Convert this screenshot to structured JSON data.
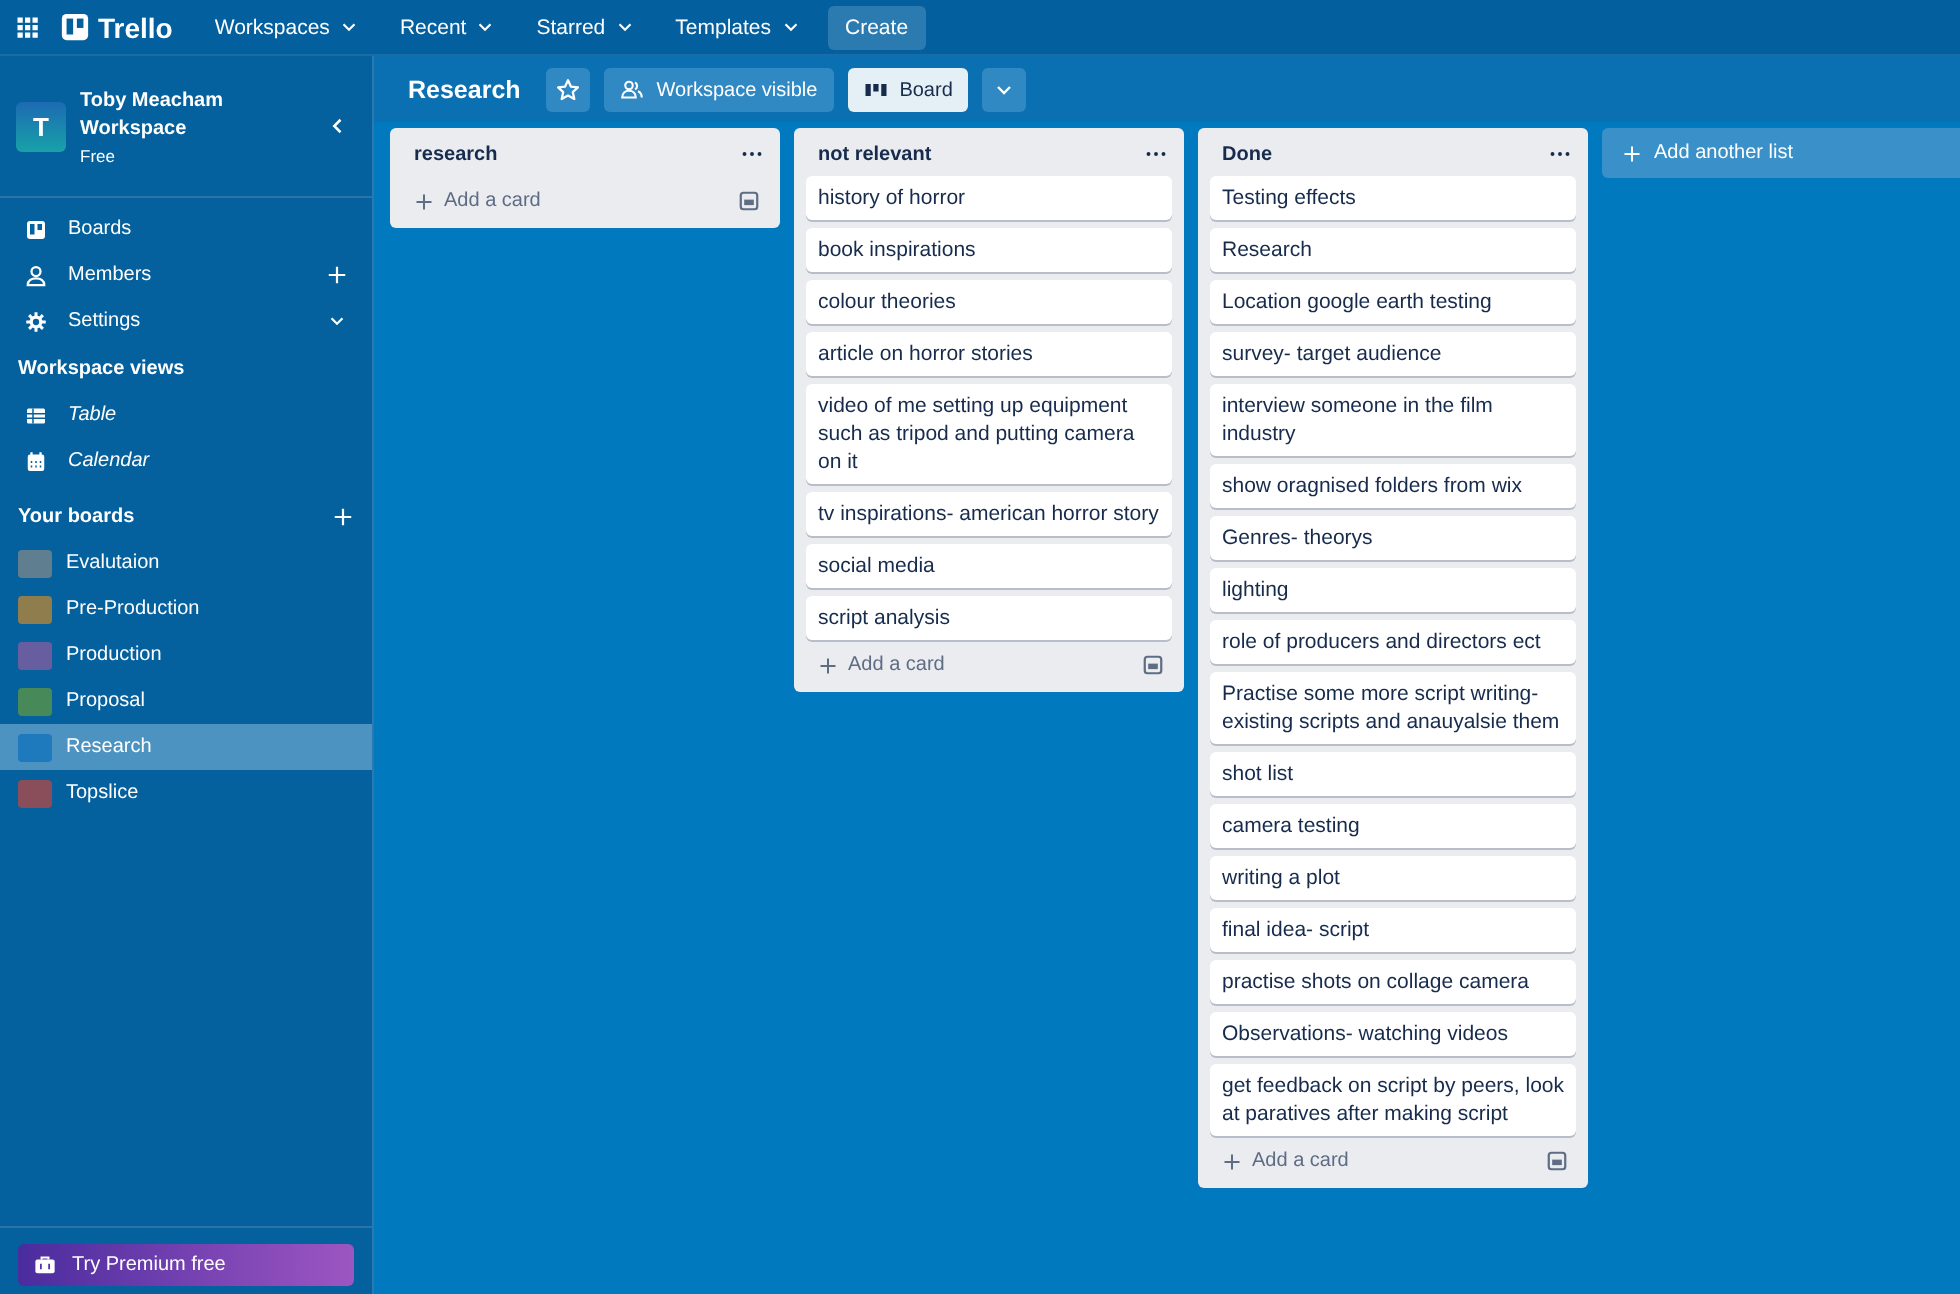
{
  "topbar": {
    "logo": "Trello",
    "menus": [
      {
        "label": "Workspaces"
      },
      {
        "label": "Recent"
      },
      {
        "label": "Starred"
      },
      {
        "label": "Templates"
      }
    ],
    "create": "Create"
  },
  "sidebar": {
    "workspace": {
      "avatar": "T",
      "name": "Toby Meacham Workspace",
      "plan": "Free"
    },
    "nav": [
      {
        "label": "Boards"
      },
      {
        "label": "Members"
      },
      {
        "label": "Settings"
      }
    ],
    "views_heading": "Workspace views",
    "views": [
      {
        "label": "Table"
      },
      {
        "label": "Calendar"
      }
    ],
    "boards_heading": "Your boards",
    "boards": [
      {
        "label": "Evalutaion",
        "color": "#5f7f91",
        "selected": false
      },
      {
        "label": "Pre-Production",
        "color": "#8f7d4d",
        "selected": false
      },
      {
        "label": "Production",
        "color": "#675ea0",
        "selected": false
      },
      {
        "label": "Proposal",
        "color": "#48895a",
        "selected": false
      },
      {
        "label": "Research",
        "color": "#1e79bd",
        "selected": true
      },
      {
        "label": "Topslice",
        "color": "#8a4d5a",
        "selected": false
      }
    ],
    "premium": "Try Premium free"
  },
  "board": {
    "title": "Research",
    "visibility": "Workspace visible",
    "views": [
      {
        "label": "Board",
        "selected": true
      }
    ],
    "lists": [
      {
        "title": "research",
        "add_card": "Add a card"
      },
      {
        "title": "not relevant",
        "cards": [
          "history of horror",
          "book inspirations",
          "colour theories",
          "article on horror stories",
          "video of me setting up equipment such as tripod and putting camera on it",
          "tv inspirations- american horror story",
          "social media",
          "script analysis"
        ],
        "add_card": "Add a card"
      },
      {
        "title": "Done",
        "cards": [
          "Testing effects",
          "Research",
          "Location google earth testing",
          "survey- target audience",
          "interview someone in the film industry",
          "show oragnised folders from wix",
          "Genres- theorys",
          "lighting",
          "role of producers and directors ect",
          "Practise some more script writing- existing scripts and anauyalsie them",
          "shot list",
          "camera testing",
          "writing a plot",
          "final idea- script",
          "practise shots on collage camera",
          "Observations- watching videos",
          "get feedback on script by peers, look at paratives after making script"
        ],
        "add_card": "Add a card"
      }
    ],
    "add_list": "Add another list"
  }
}
